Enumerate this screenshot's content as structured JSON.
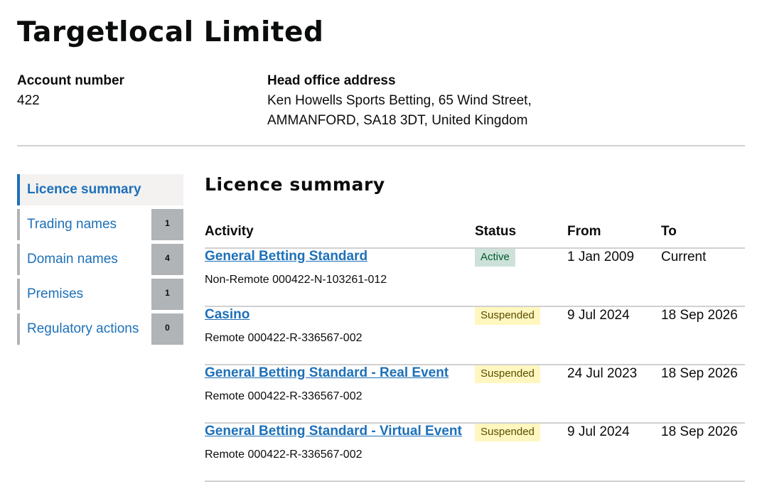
{
  "page": {
    "title": "Targetlocal Limited"
  },
  "account": {
    "label": "Account number",
    "value": "422"
  },
  "address": {
    "label": "Head office address",
    "line1": "Ken Howells Sports Betting, 65 Wind Street,",
    "line2": "AMMANFORD, SA18 3DT, United Kingdom"
  },
  "sidebar": {
    "items": [
      {
        "label": "Licence summary",
        "count": null,
        "active": true
      },
      {
        "label": "Trading names",
        "count": "1",
        "active": false
      },
      {
        "label": "Domain names",
        "count": "4",
        "active": false
      },
      {
        "label": "Premises",
        "count": "1",
        "active": false
      },
      {
        "label": "Regulatory actions",
        "count": "0",
        "active": false
      }
    ]
  },
  "main": {
    "section_title": "Licence summary",
    "table": {
      "headers": [
        "Activity",
        "Status",
        "From",
        "To"
      ],
      "rows": [
        {
          "activity": "General Betting Standard",
          "reference": "Non-Remote 000422-N-103261-012",
          "status": "Active",
          "from": "1 Jan 2009",
          "to": "Current"
        },
        {
          "activity": "Casino",
          "reference": "Remote 000422-R-336567-002",
          "status": "Suspended",
          "from": "9 Jul 2024",
          "to": "18 Sep 2026"
        },
        {
          "activity": "General Betting Standard - Real Event",
          "reference": "Remote 000422-R-336567-002",
          "status": "Suspended",
          "from": "24 Jul 2023",
          "to": "18 Sep 2026"
        },
        {
          "activity": "General Betting Standard - Virtual Event",
          "reference": "Remote 000422-R-336567-002",
          "status": "Suspended",
          "from": "9 Jul 2024",
          "to": "18 Sep 2026"
        }
      ]
    }
  },
  "colors": {
    "link": "#1d70b8",
    "active_tag_bg": "#cce2d8",
    "active_tag_text": "#005a30",
    "suspended_tag_bg": "#fff7bf",
    "suspended_tag_text": "#594d00",
    "count_badge_bg": "#b1b4b6"
  }
}
